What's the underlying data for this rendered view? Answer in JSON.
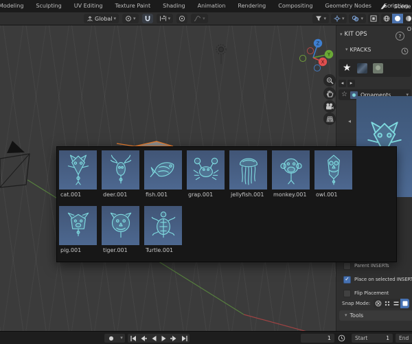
{
  "topbar": {
    "tabs": [
      "Modeling",
      "Sculpting",
      "UV Editing",
      "Texture Paint",
      "Shading",
      "Animation",
      "Rendering",
      "Compositing",
      "Geometry Nodes",
      "Scripting"
    ],
    "new_tab": "+",
    "scene": "Scene"
  },
  "header": {
    "orientation": "Global"
  },
  "panel": {
    "tab_letter": "O",
    "title": "KIT OPS",
    "help": "?",
    "kpacks_title": "KPACKS",
    "pack_selector": "Ornaments",
    "options": {
      "parent": {
        "label": "Parent INSERTs",
        "checked": false
      },
      "place": {
        "label": "Place on selected INSERT",
        "checked": true
      },
      "flip": {
        "label": "Flip Placement",
        "checked": false
      }
    },
    "snap_label": "Snap Mode:",
    "snap_modes": [
      {
        "name": "none",
        "active": false
      },
      {
        "name": "vertex",
        "active": false
      },
      {
        "name": "edge",
        "active": false
      },
      {
        "name": "face",
        "active": true
      }
    ],
    "tools_title": "Tools"
  },
  "popup": {
    "items": [
      {
        "label": "cat.001",
        "variant": "cat"
      },
      {
        "label": "deer.001",
        "variant": "deer"
      },
      {
        "label": "fish.001",
        "variant": "fish"
      },
      {
        "label": "grap.001",
        "variant": "crab"
      },
      {
        "label": "jellyfish.001",
        "variant": "jellyfish"
      },
      {
        "label": "monkey.001",
        "variant": "monkey"
      },
      {
        "label": "owl.001",
        "variant": "owl"
      },
      {
        "label": "pig.001",
        "variant": "pig"
      },
      {
        "label": "tiger.001",
        "variant": "tiger"
      },
      {
        "label": "Turtle.001",
        "variant": "turtle"
      }
    ]
  },
  "preview": {
    "variant": "cat"
  },
  "timeline": {
    "current_frame": "1",
    "start_label": "Start",
    "start_value": "1",
    "end_label": "End"
  },
  "icons": {
    "chevron_down": "▾",
    "star_filled": "★",
    "star_outline": "☆",
    "arrow_left": "◂",
    "arrow_right": "▸",
    "record_dot": "●",
    "check": "✓"
  },
  "colors": {
    "accent": "#4772b3",
    "ornament": "#7fdbe0",
    "thumb_bg": "#47608a"
  }
}
